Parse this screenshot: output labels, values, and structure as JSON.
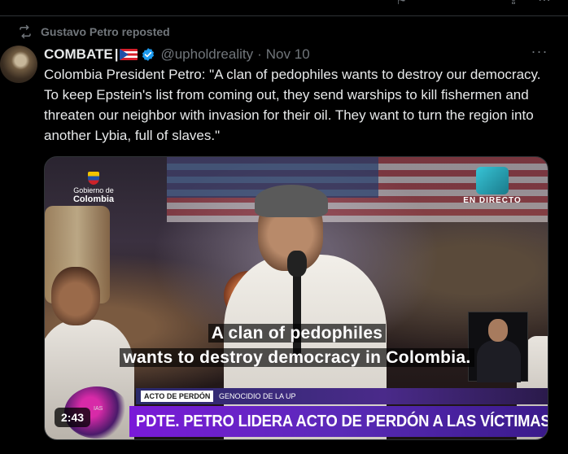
{
  "repost": {
    "label": "Gustavo Petro reposted",
    "icon": "repost-icon"
  },
  "author": {
    "display_name": "COMBATE",
    "separator": "|",
    "handle": "@upholdreality",
    "dot": "·",
    "date": "Nov 10",
    "verified_color": "#1d9bf0"
  },
  "more_label": "···",
  "tweet": {
    "text": "Colombia President Petro: \"A clan of pedophiles wants to destroy our democracy. To keep Epstein's list from coming out, they send warships to kill fishermen and threaten our neighbor with invasion for their oil. They want to turn the region into another Lybia, full of slaves.\""
  },
  "video": {
    "gov_logo_line1": "Gobierno de",
    "gov_logo_line2": "Colombia",
    "live_label": "EN DIRECTO",
    "caption_line1": "A clan of pedophiles",
    "caption_line2": "wants to destroy democracy in Colombia.",
    "lower_third_tag": "ACTO DE PERDÓN",
    "lower_third_sub": "GENOCIDIO DE LA UP",
    "lower_third_title": "PDTE. PETRO LIDERA ACTO DE PERDÓN A LAS VÍCTIMAS",
    "channel_logo_text": "IAS",
    "duration": "2:43"
  },
  "colors": {
    "background": "#000000",
    "text": "#e7e9ea",
    "muted": "#71767b",
    "border": "#2f3336",
    "lower_third_purple": "#7a1ad8"
  }
}
